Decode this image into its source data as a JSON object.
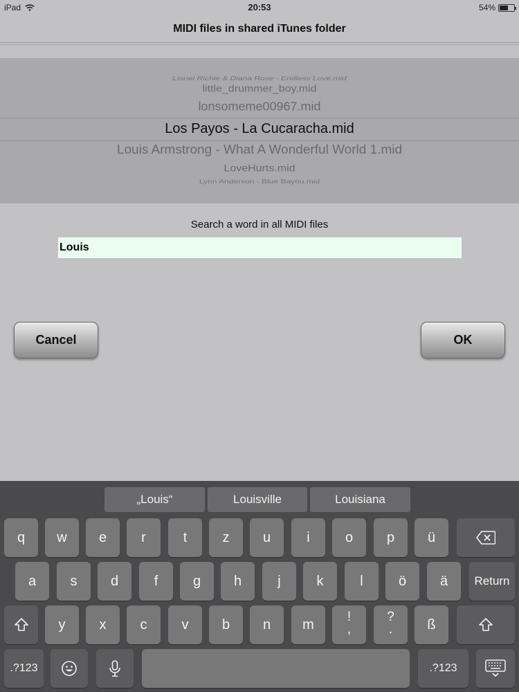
{
  "status": {
    "device": "iPad",
    "time": "20:53",
    "battery": "54%"
  },
  "nav": {
    "title": "MIDI files in shared iTunes folder"
  },
  "picker": {
    "items": [
      "Lionel Richie & Diana Rose - Endless Love.mid",
      "little_drummer_boy.mid",
      "lonsomeme00967.mid",
      "Los Payos - La Cucaracha.mid",
      "Louis Armstrong - What A Wonderful World 1.mid",
      "LoveHurts.mid",
      "Lynn Anderson - Blue Bayou.mid"
    ],
    "selected_index": 3
  },
  "search": {
    "label": "Search a word in all MIDI files",
    "value": "Louis"
  },
  "buttons": {
    "cancel": "Cancel",
    "ok": "OK"
  },
  "keyboard": {
    "suggestions": [
      "„Louis“",
      "Louisville",
      "Louisiana"
    ],
    "row1": [
      "q",
      "w",
      "e",
      "r",
      "t",
      "z",
      "u",
      "i",
      "o",
      "p",
      "ü"
    ],
    "row2": [
      "a",
      "s",
      "d",
      "f",
      "g",
      "h",
      "j",
      "k",
      "l",
      "ö",
      "ä"
    ],
    "row3": [
      "y",
      "x",
      "c",
      "v",
      "b",
      "n",
      "m"
    ],
    "punct1": [
      "!",
      ","
    ],
    "punct2": [
      "?",
      "."
    ],
    "sz": "ß",
    "return": "Return",
    "numbers": ".?123"
  }
}
